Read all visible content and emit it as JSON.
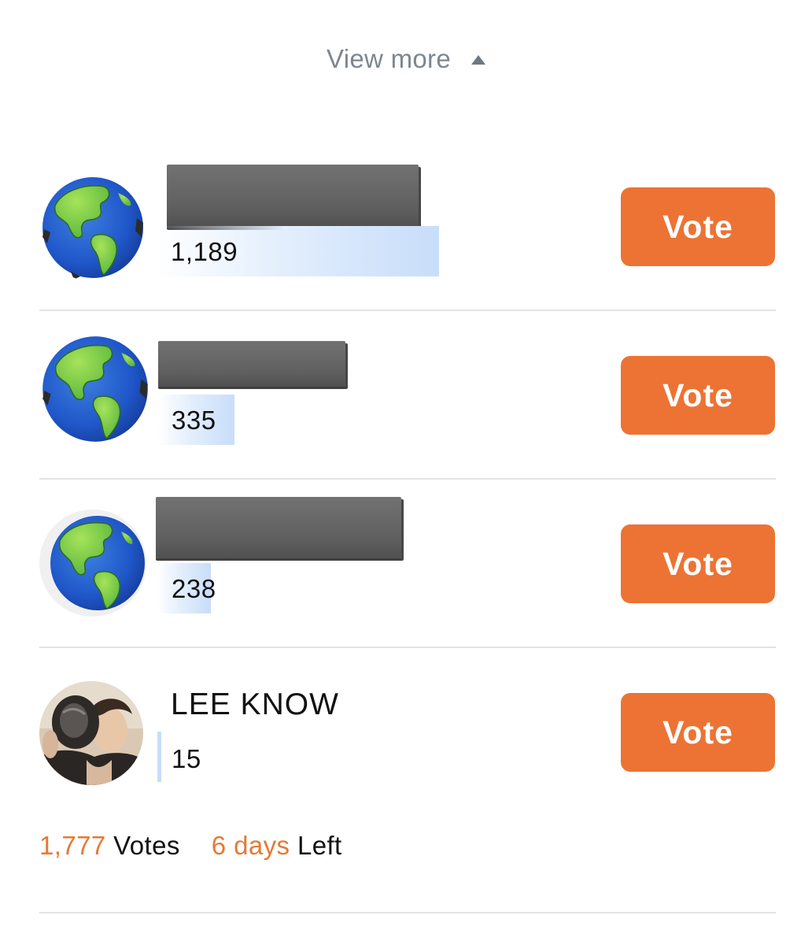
{
  "view_more": {
    "label": "View more",
    "icon": "triangle-up-icon"
  },
  "colors": {
    "accent": "#ec7334",
    "bar": "#c8ddfa",
    "muted_text": "#7d8690"
  },
  "candidates": [
    {
      "name": "",
      "name_redacted": true,
      "avatar": "globe-emoji",
      "votes": "1,189",
      "vote_label": "Vote"
    },
    {
      "name": "",
      "name_redacted": true,
      "avatar": "globe-emoji",
      "votes": "335",
      "vote_label": "Vote"
    },
    {
      "name": "",
      "name_redacted": true,
      "avatar": "globe-emoji",
      "votes": "238",
      "vote_label": "Vote"
    },
    {
      "name": "LEE KNOW",
      "name_redacted": false,
      "avatar": "profile-photo",
      "votes": "15",
      "vote_label": "Vote"
    }
  ],
  "footer": {
    "total_votes": "1,777",
    "votes_label": "Votes",
    "days_left": "6 days",
    "left_label": "Left"
  }
}
